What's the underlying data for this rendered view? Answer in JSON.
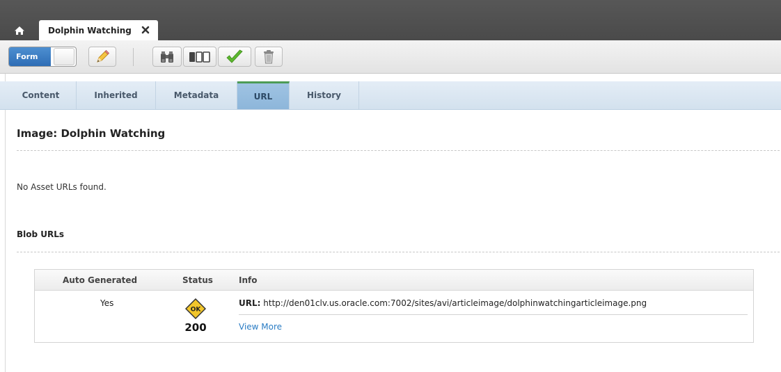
{
  "tabs": {
    "document_tab_title": "Dolphin Watching"
  },
  "toolbar": {
    "form_toggle_label": "Form",
    "buttons": [
      "edit",
      "search",
      "preview",
      "approve",
      "delete"
    ]
  },
  "subtabs": [
    "Content",
    "Inherited",
    "Metadata",
    "URL",
    "History"
  ],
  "active_subtab": "URL",
  "page": {
    "title": "Image: Dolphin Watching",
    "no_asset_urls": "No Asset URLs found.",
    "blob_section_title": "Blob URLs"
  },
  "blob_table": {
    "headers": [
      "Auto Generated",
      "Status",
      "Info"
    ],
    "rows": [
      {
        "auto_generated": "Yes",
        "status_badge": "OK",
        "status_code": "200",
        "url_label": "URL:",
        "url": "http://den01clv.us.oracle.com:7002/sites/avi/articleimage/dolphinwatchingarticleimage.png",
        "view_more": "View More"
      }
    ]
  },
  "colors": {
    "topbar": "#4f4f4f",
    "form_toggle": "#3a7dc4",
    "active_tab": "#98bfe1",
    "active_tab_indicator": "#4c9b56",
    "link": "#2a7cc4",
    "ok_badge": "#f2c62b"
  }
}
